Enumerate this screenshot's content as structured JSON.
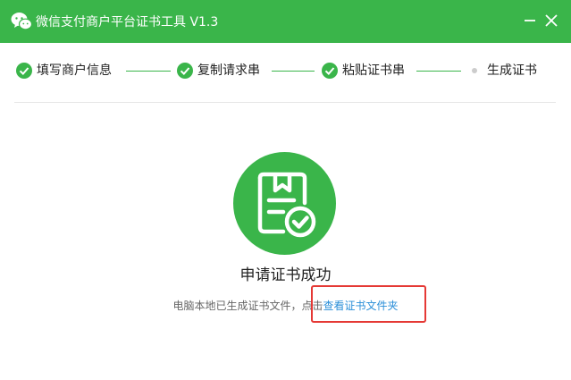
{
  "window": {
    "title": "微信支付商户平台证书工具 V1.3",
    "icons": {
      "logo": "wechat-icon",
      "minimize": "minimize-icon",
      "close": "close-icon"
    }
  },
  "steps": [
    {
      "label": "填写商户信息",
      "status": "done"
    },
    {
      "label": "复制请求串",
      "status": "done"
    },
    {
      "label": "粘贴证书串",
      "status": "done"
    },
    {
      "label": "生成证书",
      "status": "current"
    }
  ],
  "result": {
    "icon": "certificate-check-icon",
    "title": "申请证书成功",
    "description": "电脑本地已生成证书文件，点击",
    "folder_link": "查看证书文件夹"
  },
  "colors": {
    "brand_green": "#3ab54a",
    "link_blue": "#2b8fd8",
    "highlight_red": "#e53935"
  }
}
